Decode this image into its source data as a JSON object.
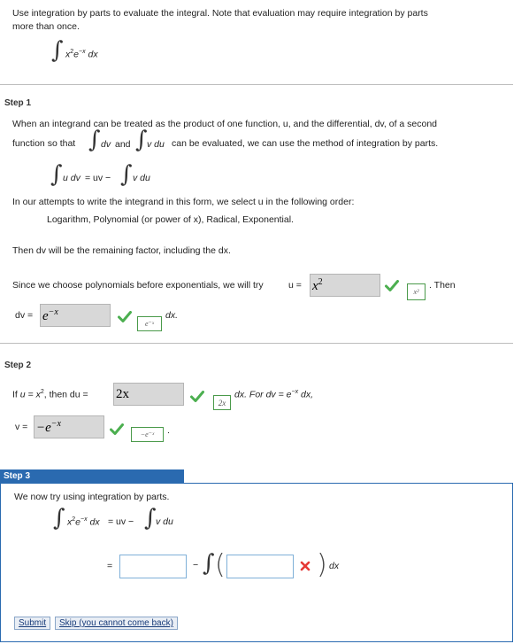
{
  "problem": {
    "line1": "Use integration by parts to evaluate the integral. Note that evaluation may require integration by parts",
    "line2": "more than once.",
    "integrand_base": "x",
    "integrand_exp1": "2",
    "integrand_e": "e",
    "integrand_exp2": "−x",
    "integrand_dx": "dx"
  },
  "step1": {
    "label": "Step 1",
    "para_line1": "When an integrand can be treated as the product of one function, u, and the differential, dv, of a second",
    "para_line2_a": "function so that",
    "para_line2_dv": "dv",
    "para_line2_and": "and",
    "para_line2_vdu": "v du",
    "para_line2_b": "can be evaluated, we can use the method of integration by parts.",
    "formula_lhs": "u dv",
    "formula_mid": "= uv −",
    "formula_rhs": "v du",
    "order_intro": "In our attempts to write the integrand in this form, we select u in the following order:",
    "order_list": "Logarithm, Polynomial (or power of x), Radical, Exponential.",
    "then_dv": "Then dv will be the remaining factor, including the dx.",
    "since_text": "Since we choose polynomials before exponentials, we will try",
    "u_eq": "u =",
    "u_answer_base": "x",
    "u_answer_exp": "2",
    "u_preview": "x²",
    "then_text": "Then",
    "dv_eq": "dv =",
    "dv_answer_base": "e",
    "dv_answer_exp": "−x",
    "dv_preview": "e⁻ˣ",
    "dv_dx": "dx."
  },
  "step2": {
    "label": "Step 2",
    "if_text": "If",
    "u_expr": "u = x",
    "u_exp": "2",
    "then_du": ", then du =",
    "du_answer": "2x",
    "du_preview": "2x",
    "dx_for": "dx.  For  dv = e",
    "dv_exp": "−x",
    "dv_tail": "dx,",
    "v_eq": "v =",
    "v_answer_base": "−e",
    "v_answer_exp": "−x",
    "v_preview": "−e⁻ˣ",
    "v_period": "."
  },
  "step3": {
    "label": "Step 3",
    "intro": "We now try using integration by parts.",
    "lhs_base": "x",
    "lhs_exp1": "2",
    "lhs_e": "e",
    "lhs_exp2": "−x",
    "lhs_dx": "dx",
    "mid": "= uv −",
    "rhs": "v du",
    "eq_sign": "=",
    "minus": "−",
    "dx": "dx",
    "input1_value": "",
    "input2_value": ""
  },
  "buttons": {
    "submit": "Submit",
    "skip": "Skip (you cannot come back)"
  },
  "colors": {
    "check": "#4caf50",
    "cross": "#e53935",
    "step3_accent": "#2a6ab0"
  }
}
